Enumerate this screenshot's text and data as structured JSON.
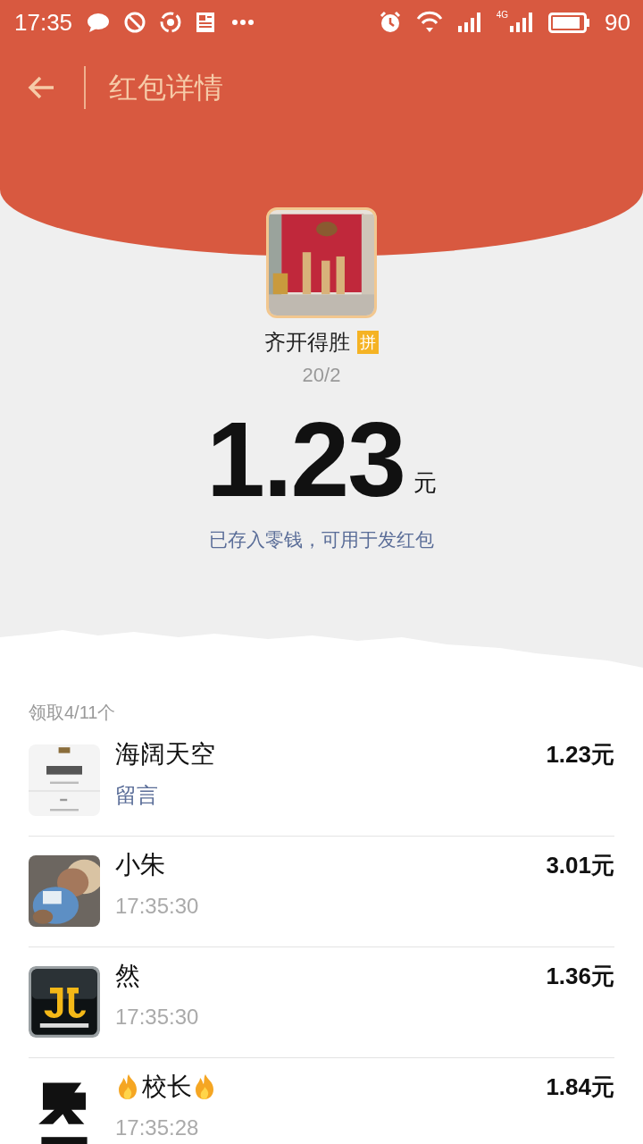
{
  "status_bar": {
    "time": "17:35",
    "network": "4G",
    "battery": "90"
  },
  "header": {
    "title": "红包详情"
  },
  "sender": {
    "name": "齐开得胜",
    "badge": "拼",
    "subtitle": "20/2"
  },
  "amount": {
    "value": "1.23",
    "unit": "元"
  },
  "notice": "已存入零钱，可用于发红包",
  "list": {
    "heading": "领取4/11个",
    "rows": [
      {
        "kind": "message",
        "name": "海阔天空",
        "detail": "留言",
        "amount": "1.23元"
      },
      {
        "kind": "time",
        "name": "小朱",
        "detail": "17:35:30",
        "amount": "3.01元"
      },
      {
        "kind": "time",
        "name": "然",
        "detail": "17:35:30",
        "amount": "1.36元"
      },
      {
        "kind": "flame",
        "name": "校长",
        "detail": "17:35:28",
        "amount": "1.84元"
      }
    ]
  }
}
